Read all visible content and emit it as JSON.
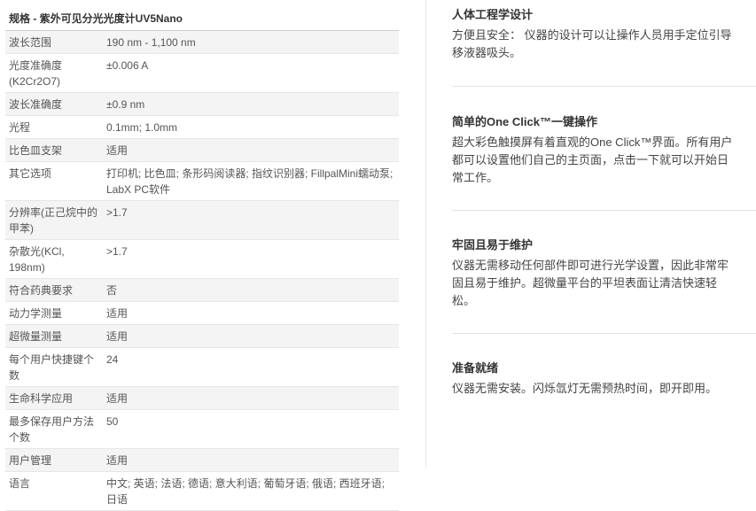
{
  "spec": {
    "title": "规格 - 紫外可见分光光度计UV5Nano",
    "rows": [
      {
        "key": "波长范围",
        "value": "190 nm - 1,100 nm"
      },
      {
        "key": "光度准确度 (K2Cr2O7)",
        "value": "±0.006 A"
      },
      {
        "key": "波长准确度",
        "value": "±0.9 nm"
      },
      {
        "key": "光程",
        "value": "0.1mm; 1.0mm"
      },
      {
        "key": "比色皿支架",
        "value": "适用"
      },
      {
        "key": "其它选项",
        "value": "打印机; 比色皿; 条形码阅读器; 指纹识别器; FillpalMini蠕动泵; LabX PC软件"
      },
      {
        "key": "分辨率(正己烷中的甲苯)",
        "value": ">1.7"
      },
      {
        "key": "杂散光(KCl, 198nm)",
        "value": ">1.7"
      },
      {
        "key": "符合药典要求",
        "value": "否"
      },
      {
        "key": "动力学测量",
        "value": "适用"
      },
      {
        "key": "超微量测量",
        "value": "适用"
      },
      {
        "key": "每个用户快捷键个数",
        "value": "24"
      },
      {
        "key": "生命科学应用",
        "value": "适用"
      },
      {
        "key": "最多保存用户方法个数",
        "value": "50"
      },
      {
        "key": "用户管理",
        "value": "适用"
      },
      {
        "key": "语言",
        "value": "中文; 英语; 法语; 德语; 意大利语; 葡萄牙语; 俄语; 西班牙语; 日语"
      }
    ]
  },
  "features": [
    {
      "title": "人体工程学设计",
      "text": "方便且安全： 仪器的设计可以让操作人员用手定位引导移液器吸头。"
    },
    {
      "title": "简单的One Click™一键操作",
      "text": "超大彩色触摸屏有着直观的One Click™界面。所有用户都可以设置他们自己的主页面，点击一下就可以开始日常工作。"
    },
    {
      "title": "牢固且易于维护",
      "text": "仪器无需移动任何部件即可进行光学设置，因此非常牢固且易于维护。超微量平台的平坦表面让清洁快速轻松。"
    },
    {
      "title": "准备就绪",
      "text": "仪器无需安装。闪烁氙灯无需预热时间，即开即用。"
    }
  ]
}
